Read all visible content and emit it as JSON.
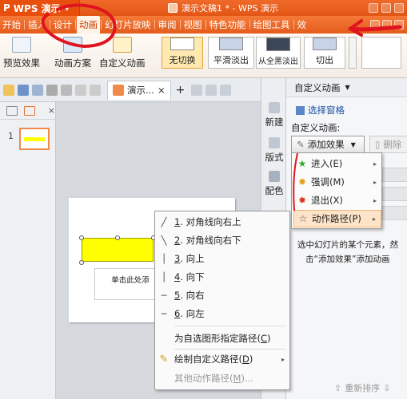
{
  "app": {
    "logo": "P",
    "name": "WPS 演示",
    "caret": "▼"
  },
  "title": {
    "doc": "演示文稿1 * - WPS 演示"
  },
  "menubar": {
    "items": [
      "开始",
      "插入",
      "设计",
      "动画",
      "幻灯片放映",
      "审阅",
      "视图",
      "特色功能",
      "绘图工具",
      "效"
    ],
    "active_index": 3
  },
  "ribbon": {
    "preview": "预览效果",
    "scheme": "动画方案",
    "custom": "自定义动画",
    "transitions": [
      "无切换",
      "平滑淡出",
      "从全黑淡出",
      "切出"
    ]
  },
  "tabbar": {
    "doc_tab": "演示...",
    "close": "×",
    "new": "+"
  },
  "slide_panel": {
    "thumb_number": "1"
  },
  "slide": {
    "placeholder": "单击此处添"
  },
  "context_menu": {
    "items": [
      {
        "icon": "╱",
        "key": "1",
        "label": ". 对角线向右上"
      },
      {
        "icon": "╲",
        "key": "2",
        "label": ". 对角线向右下"
      },
      {
        "icon": "│",
        "key": "3",
        "label": ". 向上"
      },
      {
        "icon": "│",
        "key": "4",
        "label": ". 向下"
      },
      {
        "icon": "─",
        "key": "5",
        "label": ". 向右"
      },
      {
        "icon": "─",
        "key": "6",
        "label": ". 向左"
      }
    ],
    "specify_path": {
      "label": "为自选图形指定路径(",
      "key": "C",
      "end": ")"
    },
    "draw_path": {
      "label": "绘制自定义路径(",
      "key": "D",
      "end": ")"
    },
    "other_path": {
      "label": "其他动作路径(",
      "key": "M",
      "end": ")..."
    }
  },
  "side_column": {
    "new": "新建",
    "layout": "版式",
    "color": "配色"
  },
  "task_pane": {
    "header": "自定义动画",
    "select_pane": "选择窗格",
    "label": "自定义动画:",
    "add_effect": "添加效果",
    "delete": "删除",
    "hint_line1": "选中幻灯片的某个元素，然",
    "hint_line2": "击“添加效果”添加动画",
    "reorder": "重新排序"
  },
  "sub_menu": {
    "items": [
      {
        "label": "进入(E)",
        "icon": "★",
        "color": "#2fa830"
      },
      {
        "label": "强调(M)",
        "icon": "✹",
        "color": "#e8a010"
      },
      {
        "label": "退出(X)",
        "icon": "✸",
        "color": "#d23a2a"
      },
      {
        "label": "动作路径(P)",
        "icon": "☆",
        "color": "#555555"
      }
    ],
    "active_index": 3
  },
  "colors": {
    "accent": "#e45c1c",
    "annotation_red": "#e0141e",
    "highlight_yellow": "#ffff00"
  }
}
